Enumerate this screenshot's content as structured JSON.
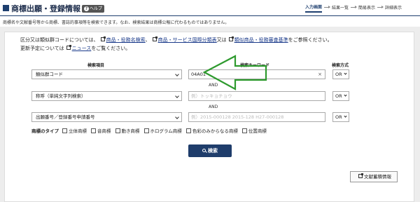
{
  "header": {
    "title": "商標出願・登録情報",
    "help_label": "ヘルプ",
    "subtitle": "商標名や文献番号等から商標、書誌的事項等を検索できます。なお、検索結果は商標公報に代わるものではありません。"
  },
  "steps": [
    {
      "label": "入力画面",
      "active": true
    },
    {
      "label": "結果一覧",
      "active": false
    },
    {
      "label": "簡易表示",
      "active": false
    },
    {
      "label": "詳細表示",
      "active": false
    }
  ],
  "info": {
    "line1_prefix": "区分又は類似群コードについては、",
    "link1": "商品・役務名検索",
    "sep1": "、",
    "link2": "商品・サービス国際分類表",
    "sep2": "又は",
    "link3": "類似商品・役務審査基準",
    "line1_suffix": "をご参照ください。",
    "line2_prefix": "更新予定については",
    "link4": "ニュース",
    "line2_suffix": "をご覧ください。"
  },
  "columns": {
    "item": "検索項目",
    "keyword": "検索キーワード",
    "method": "検索方式"
  },
  "rows": [
    {
      "field": "類似群コード",
      "value": "04A01",
      "placeholder": "",
      "method": "OR"
    },
    {
      "field": "称呼（単純文字列検索）",
      "value": "",
      "placeholder": "例）トッキョチョウ",
      "method": "OR"
    },
    {
      "field": "出願番号／登録番号申請番号",
      "value": "",
      "placeholder": "例）2015-000128 2015-128 H27-000128",
      "method": "OR"
    }
  ],
  "and_label": "AND",
  "mark_types": {
    "label": "商標のタイプ",
    "options": [
      "立体商標",
      "音商標",
      "動き商標",
      "ホログラム商標",
      "色彩のみからなる商標",
      "位置商標"
    ]
  },
  "search_button": "検索",
  "doc_button": "文献蓄積情報",
  "colors": {
    "navy": "#1f3d6b",
    "arrow": "#2e9a2e"
  }
}
